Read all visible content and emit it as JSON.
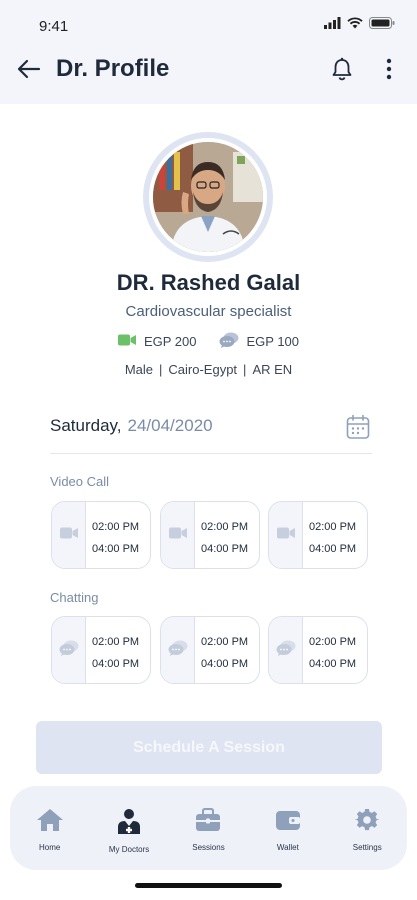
{
  "status_bar": {
    "time": "9:41"
  },
  "header": {
    "title": "Dr. Profile"
  },
  "doctor": {
    "name": "DR. Rashed Galal",
    "specialty": "Cardiovascular specialist",
    "video_price": "EGP 200",
    "chat_price": "EGP 100",
    "gender": "Male",
    "location": "Cairo-Egypt",
    "languages": "AR EN"
  },
  "date": {
    "day": "Saturday,",
    "value": "24/04/2020"
  },
  "video_call": {
    "label": "Video Call",
    "slots": [
      {
        "start": "02:00 PM",
        "end": "04:00 PM"
      },
      {
        "start": "02:00 PM",
        "end": "04:00 PM"
      },
      {
        "start": "02:00 PM",
        "end": "04:00 PM"
      }
    ]
  },
  "chatting": {
    "label": "Chatting",
    "slots": [
      {
        "start": "02:00 PM",
        "end": "04:00 PM"
      },
      {
        "start": "02:00 PM",
        "end": "04:00 PM"
      },
      {
        "start": "02:00 PM",
        "end": "04:00 PM"
      }
    ]
  },
  "schedule_button": "Schedule A Session",
  "bottom_nav": {
    "items": [
      {
        "label": "Home",
        "icon": "home-icon"
      },
      {
        "label": "My Doctors",
        "icon": "doctor-icon"
      },
      {
        "label": "Sessions",
        "icon": "briefcase-icon"
      },
      {
        "label": "Wallet",
        "icon": "wallet-icon"
      },
      {
        "label": "Settings",
        "icon": "gear-icon"
      }
    ]
  },
  "colors": {
    "accent_green": "#6cc06a",
    "muted_blue": "#7a8ca6",
    "disabled_button": "#dfe4f2"
  }
}
